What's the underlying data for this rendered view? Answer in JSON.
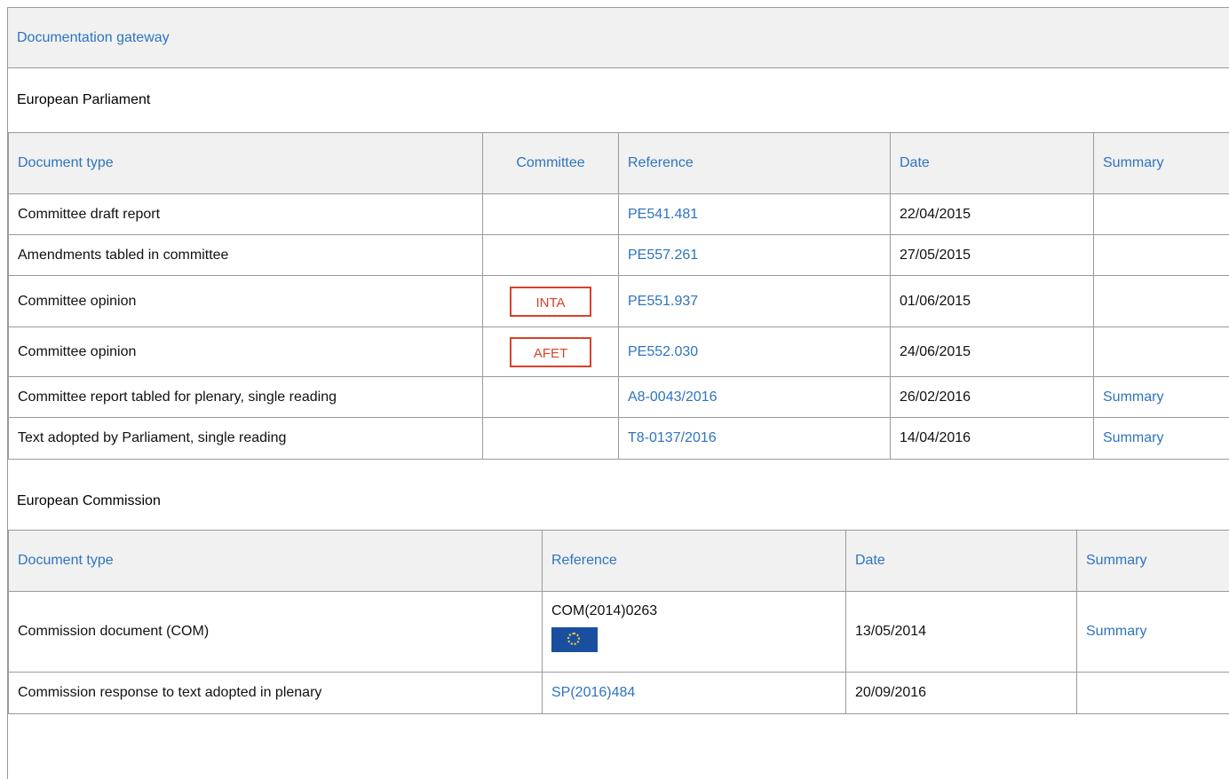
{
  "gateway": {
    "title": "Documentation gateway"
  },
  "ep": {
    "title": "European Parliament",
    "headers": {
      "doc_type": "Document type",
      "committee": "Committee",
      "reference": "Reference",
      "date": "Date",
      "summary": "Summary"
    },
    "rows": [
      {
        "doc_type": "Committee draft report",
        "committee": "",
        "reference": "PE541.481",
        "date": "22/04/2015",
        "summary": ""
      },
      {
        "doc_type": "Amendments tabled in committee",
        "committee": "",
        "reference": "PE557.261",
        "date": "27/05/2015",
        "summary": ""
      },
      {
        "doc_type": "Committee opinion",
        "committee": "INTA",
        "reference": "PE551.937",
        "date": "01/06/2015",
        "summary": ""
      },
      {
        "doc_type": "Committee opinion",
        "committee": "AFET",
        "reference": "PE552.030",
        "date": "24/06/2015",
        "summary": ""
      },
      {
        "doc_type": "Committee report tabled for plenary, single reading",
        "committee": "",
        "reference": "A8-0043/2016",
        "date": "26/02/2016",
        "summary": "Summary"
      },
      {
        "doc_type": "Text adopted by Parliament, single reading",
        "committee": "",
        "reference": "T8-0137/2016",
        "date": "14/04/2016",
        "summary": "Summary"
      }
    ]
  },
  "ec": {
    "title": "European Commission",
    "headers": {
      "doc_type": "Document type",
      "reference": "Reference",
      "date": "Date",
      "summary": "Summary"
    },
    "rows": [
      {
        "doc_type": "Commission document (COM)",
        "reference": "COM(2014)0263",
        "reference_icon": "eu-flag-icon",
        "date": "13/05/2014",
        "summary": "Summary"
      },
      {
        "doc_type": "Commission response to text adopted in plenary",
        "reference": "SP(2016)484",
        "date": "20/09/2016",
        "summary": ""
      }
    ]
  },
  "colors": {
    "link": "#2e74c0",
    "committee_badge": "#d9412a",
    "header_bg": "#f1f1f1",
    "border": "#9a9a9a"
  }
}
